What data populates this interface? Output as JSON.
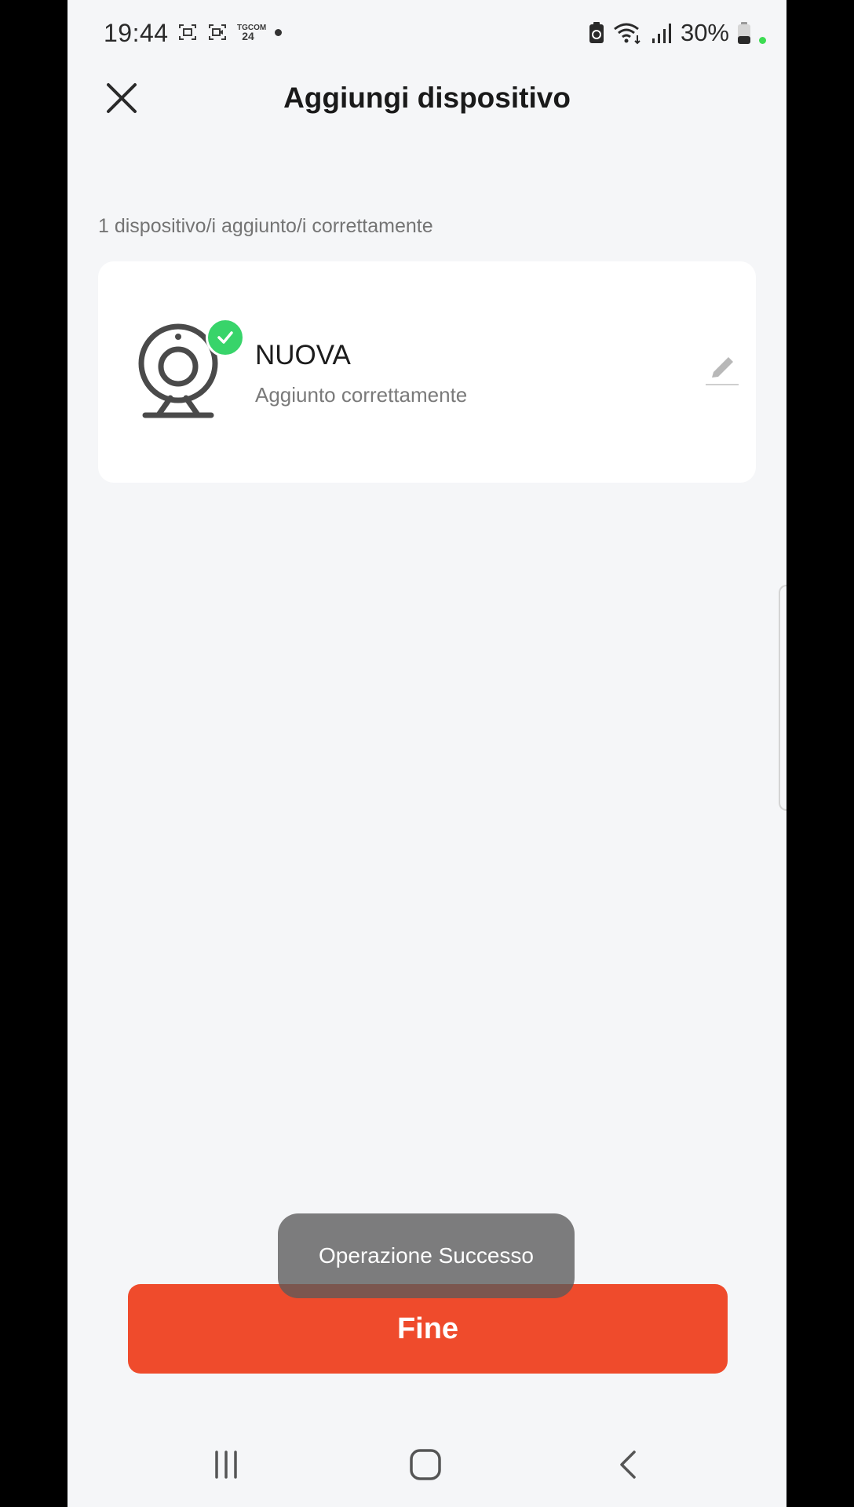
{
  "status_bar": {
    "time": "19:44",
    "news_badge_top": "TGCOM",
    "news_badge_bottom": "24",
    "battery": "30%",
    "icons": [
      "screenshot-icon",
      "video-record-icon",
      "tgcom24-icon",
      "notification-dot-icon",
      "battery-saver-icon",
      "wifi-icon",
      "signal-icon",
      "battery-icon"
    ]
  },
  "header": {
    "title": "Aggiungi dispositivo",
    "close_icon": "close-icon"
  },
  "main": {
    "section_label": "1 dispositivo/i aggiunto/i correttamente",
    "devices": [
      {
        "name": "NUOVA",
        "status": "Aggiunto correttamente",
        "icon": "webcam-icon",
        "badge_icon": "check-icon",
        "edit_icon": "pencil-icon"
      }
    ]
  },
  "toast": {
    "message": "Operazione Successo"
  },
  "actions": {
    "done_label": "Fine"
  },
  "nav": {
    "icons": [
      "recent-apps-icon",
      "home-icon",
      "back-icon"
    ]
  },
  "colors": {
    "accent": "#ef4b2c",
    "success": "#38d46a",
    "background": "#f5f6f8",
    "card": "#ffffff"
  }
}
